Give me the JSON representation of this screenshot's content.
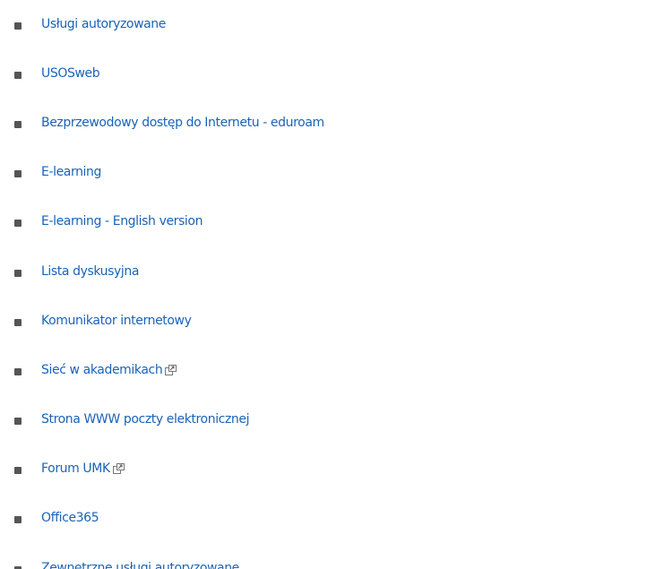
{
  "links": [
    {
      "label": "Usługi autoryzowane",
      "external": false
    },
    {
      "label": "USOSweb",
      "external": false
    },
    {
      "label": "Bezprzewodowy dostęp do Internetu - eduroam",
      "external": false
    },
    {
      "label": "E-learning",
      "external": false
    },
    {
      "label": "E-learning - English version",
      "external": false
    },
    {
      "label": "Lista dyskusyjna",
      "external": false
    },
    {
      "label": "Komunikator internetowy",
      "external": false
    },
    {
      "label": "Sieć w akademikach",
      "external": true
    },
    {
      "label": "Strona WWW poczty elektronicznej",
      "external": false
    },
    {
      "label": "Forum UMK",
      "external": true
    },
    {
      "label": "Office365",
      "external": false
    },
    {
      "label": "Zewnętrzne usługi autoryzowane",
      "external": false
    }
  ],
  "colors": {
    "link": "#1a63b8",
    "bullet": "#555555",
    "background": "#ffffff"
  },
  "icons": {
    "external": "external-link-icon"
  }
}
